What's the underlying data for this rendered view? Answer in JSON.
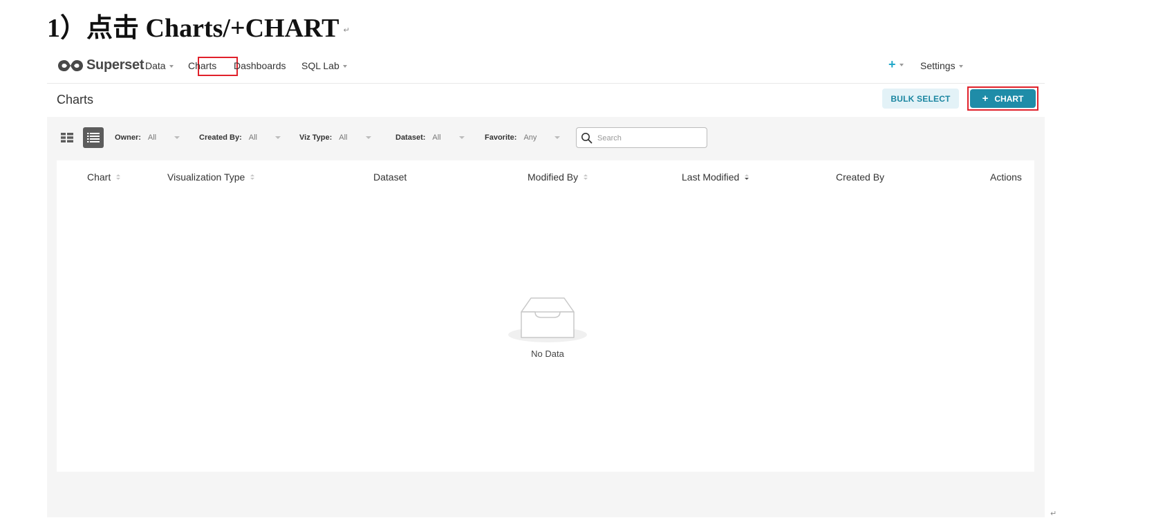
{
  "doc": {
    "heading": "1）点击 Charts/+CHART",
    "return_mark": "↵"
  },
  "navbar": {
    "brand": "Superset",
    "items": [
      {
        "label": "Data"
      },
      {
        "label": "Charts"
      },
      {
        "label": "Dashboards"
      },
      {
        "label": "SQL Lab"
      }
    ],
    "add_icon": "plus-icon",
    "settings_label": "Settings"
  },
  "subheader": {
    "title": "Charts",
    "bulk_select_label": "BULK SELECT",
    "add_chart_label": "CHART"
  },
  "filters": {
    "owner": {
      "label": "Owner:",
      "value": "All"
    },
    "created_by": {
      "label": "Created By:",
      "value": "All"
    },
    "viz_type": {
      "label": "Viz Type:",
      "value": "All"
    },
    "dataset": {
      "label": "Dataset:",
      "value": "All"
    },
    "favorite": {
      "label": "Favorite:",
      "value": "Any"
    },
    "search": {
      "placeholder": "Search",
      "value": ""
    }
  },
  "table": {
    "columns": [
      "Chart",
      "Visualization Type",
      "Dataset",
      "Modified By",
      "Last Modified",
      "Created By",
      "Actions"
    ],
    "empty_text": "No Data"
  },
  "colors": {
    "accent": "#1f8ca8",
    "highlight": "#e0202a",
    "bulk_bg": "#e3f2f7"
  }
}
